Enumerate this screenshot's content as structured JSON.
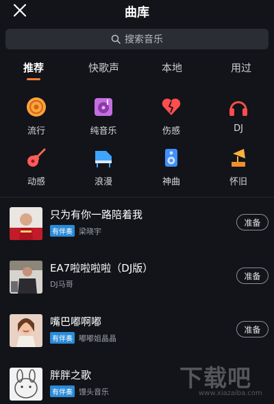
{
  "header": {
    "title": "曲库"
  },
  "search": {
    "placeholder": "搜索音乐"
  },
  "tabs": [
    {
      "label": "推荐",
      "active": true
    },
    {
      "label": "快歌声",
      "active": false
    },
    {
      "label": "本地",
      "active": false
    },
    {
      "label": "用过",
      "active": false
    }
  ],
  "categories": [
    {
      "label": "流行",
      "icon": "disc-icon"
    },
    {
      "label": "纯音乐",
      "icon": "music-note-icon"
    },
    {
      "label": "伤感",
      "icon": "broken-heart-icon"
    },
    {
      "label": "DJ",
      "icon": "headphones-icon"
    },
    {
      "label": "动感",
      "icon": "guitar-icon"
    },
    {
      "label": "浪漫",
      "icon": "piano-icon"
    },
    {
      "label": "神曲",
      "icon": "speaker-icon"
    },
    {
      "label": "怀旧",
      "icon": "gramophone-icon"
    }
  ],
  "songs": [
    {
      "title": "只为有你一路陪着我",
      "badge": "有伴奏",
      "artist": "梁晓宇",
      "button": "准备"
    },
    {
      "title": "EA7啦啦啦啦（DJ版）",
      "badge": "",
      "artist": "DJ马哥",
      "button": "准备"
    },
    {
      "title": "嘴巴嘟啊嘟",
      "badge": "有伴奏",
      "artist": "嘟嘟姐晶晶",
      "button": "准备"
    },
    {
      "title": "胖胖之歌",
      "badge": "有伴奏",
      "artist": "馒头音乐",
      "button": ""
    }
  ],
  "watermark": {
    "text": "下载吧",
    "url": "www.xiazaiba.com"
  },
  "colors": {
    "accent": "#ff7d2d",
    "badge": "#2b8bd8",
    "background": "#121419"
  }
}
